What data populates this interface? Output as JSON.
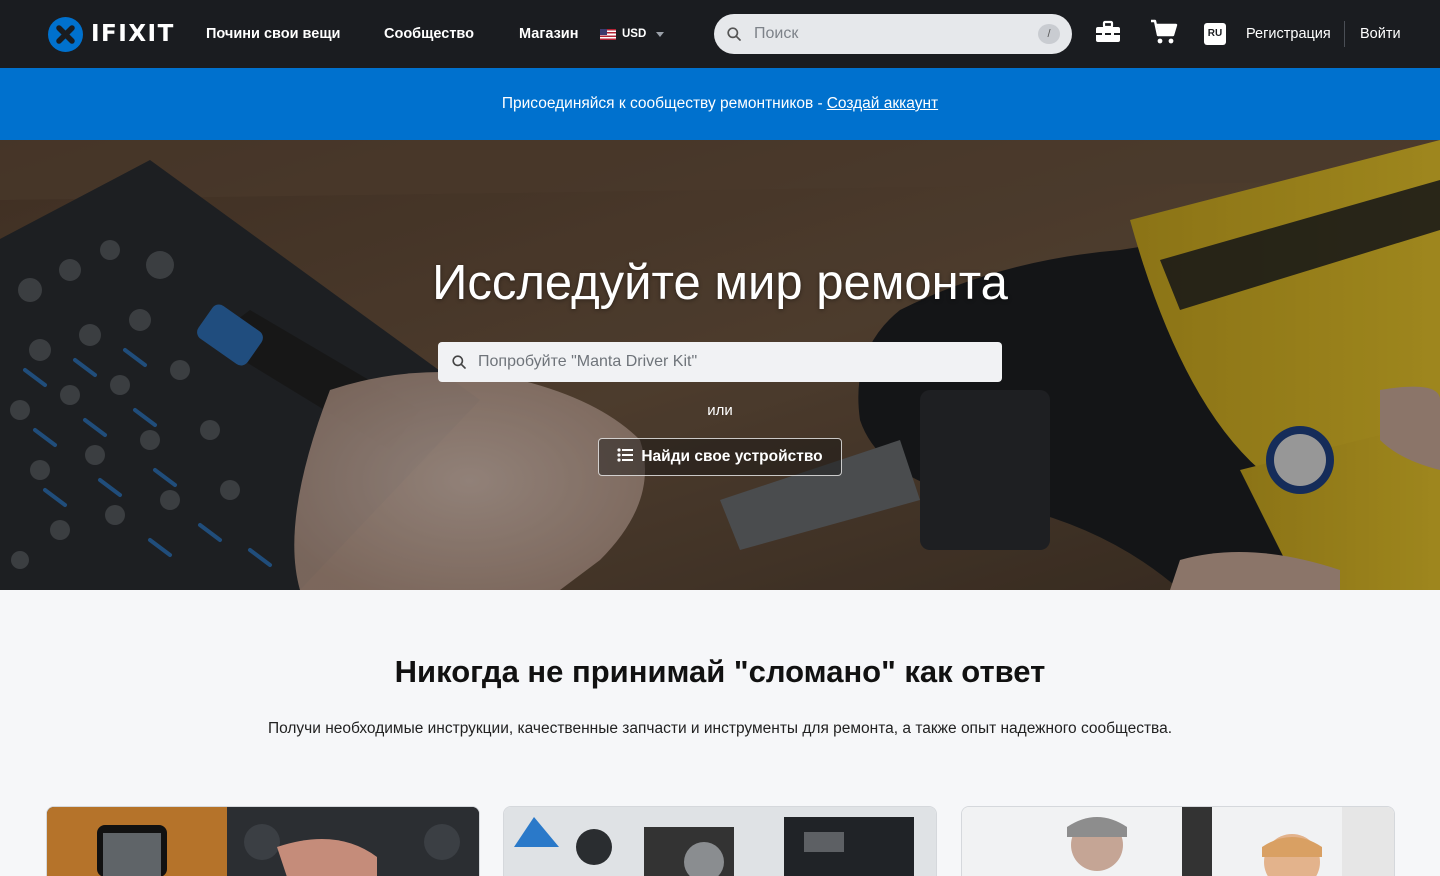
{
  "brand": {
    "name": "IFIXIT",
    "color": "#0071ce"
  },
  "nav": {
    "links": [
      "Почини свои вещи",
      "Сообщество",
      "Магазин"
    ],
    "currency": "USD",
    "search_placeholder": "Поиск",
    "search_shortcut": "/",
    "language": "RU",
    "register": "Регистрация",
    "login": "Войти"
  },
  "banner": {
    "text": "Присоединяйся к сообществу ремонтников -",
    "link": "Создай аккаунт"
  },
  "hero": {
    "title": "Исследуйте мир ремонта",
    "search_placeholder": "Попробуйте \"Manta Driver Kit\"",
    "or": "или",
    "button": "Найди свое устройство"
  },
  "intro": {
    "title": "Никогда не принимай \"сломано\" как ответ",
    "text": "Получи необходимые инструкции, качественные запчасти и инструменты для ремонта, а также опыт надежного сообщества."
  },
  "icons": {
    "logo": "ifixit-logo-icon",
    "search": "search-icon",
    "toolbox": "toolbox-icon",
    "cart": "cart-icon",
    "list": "list-icon"
  }
}
